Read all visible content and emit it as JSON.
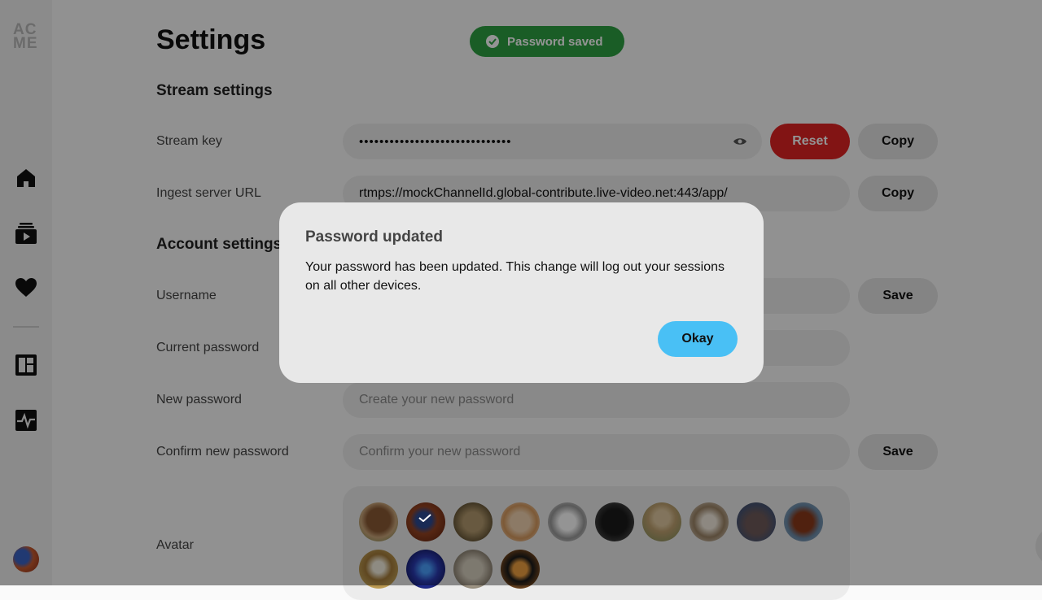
{
  "sidebar": {
    "logo": [
      "AC",
      "ME"
    ],
    "nav": [
      "home-icon",
      "channel-videos-icon",
      "following-icon",
      "dashboard-icon",
      "activity-icon"
    ]
  },
  "page": {
    "title": "Settings"
  },
  "toast": {
    "text": "Password saved",
    "color": "#2ea043"
  },
  "stream_settings": {
    "title": "Stream settings",
    "stream_key": {
      "label": "Stream key",
      "value": "••••••••••••••••••••••••••••••",
      "reset": "Reset",
      "copy": "Copy"
    },
    "ingest": {
      "label": "Ingest server URL",
      "value": "rtmps://mockChannelId.global-contribute.live-video.net:443/app/",
      "copy": "Copy"
    }
  },
  "account_settings": {
    "title": "Account settings",
    "username": {
      "label": "Username",
      "save": "Save"
    },
    "current_password": {
      "label": "Current password"
    },
    "new_password": {
      "label": "New password",
      "placeholder": "Create your new password"
    },
    "confirm_password": {
      "label": "Confirm new password",
      "placeholder": "Confirm your new password",
      "save": "Save"
    },
    "avatar": {
      "label": "Avatar",
      "selected_index": 1
    }
  },
  "dialog": {
    "title": "Password updated",
    "body": "Your password has been updated. This change will log out your sessions on all other devices.",
    "okay": "Okay"
  },
  "colors": {
    "accent": "#49c0f5",
    "danger": "#e02424"
  }
}
